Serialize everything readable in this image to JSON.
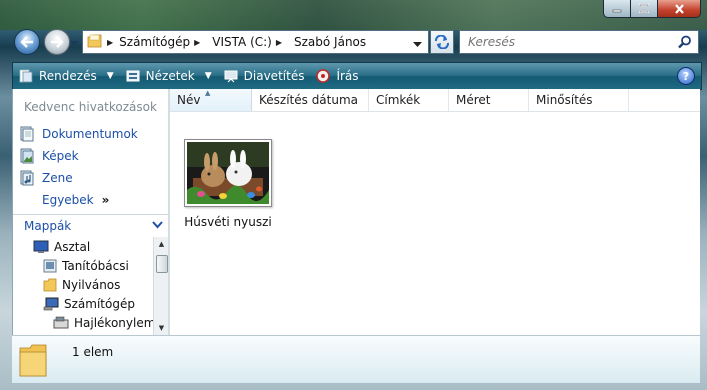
{
  "window": {
    "caption_buttons": [
      "minimize-icon",
      "maximize-icon",
      "close-icon"
    ]
  },
  "address": {
    "root_arrow": "▶",
    "segments": [
      "Számítógép",
      "VISTA (C:)",
      "Szabó János"
    ],
    "search_placeholder": "Keresés"
  },
  "toolbar": {
    "organize": "Rendezés",
    "views": "Nézetek",
    "slideshow": "Diavetítés",
    "burn": "Írás",
    "help": "?"
  },
  "sidebar": {
    "favorites_title": "Kedvenc hivatkozások",
    "favorites": [
      {
        "label": "Dokumentumok",
        "icon": "documents-icon"
      },
      {
        "label": "Képek",
        "icon": "pictures-icon"
      },
      {
        "label": "Zene",
        "icon": "music-icon"
      }
    ],
    "more_label": "Egyebek",
    "more_chevron": "»",
    "folders_title": "Mappák",
    "tree": [
      {
        "label": "Asztal",
        "icon": "desktop-icon",
        "level": 0
      },
      {
        "label": "Tanítóbácsi",
        "icon": "user-folder-icon",
        "level": 1
      },
      {
        "label": "Nyilvános",
        "icon": "folder-icon",
        "level": 1
      },
      {
        "label": "Számítógép",
        "icon": "computer-icon",
        "level": 1
      },
      {
        "label": "Hajlékonylemez",
        "icon": "floppy-icon",
        "level": 2
      }
    ]
  },
  "columns": [
    "Név",
    "Készítés dátuma",
    "Címkék",
    "Méret",
    "Minősítés"
  ],
  "files": [
    {
      "name": "Húsvéti nyuszi",
      "thumbnail": "rabbits-photo"
    }
  ],
  "status": {
    "count_text": "1 elem"
  }
}
